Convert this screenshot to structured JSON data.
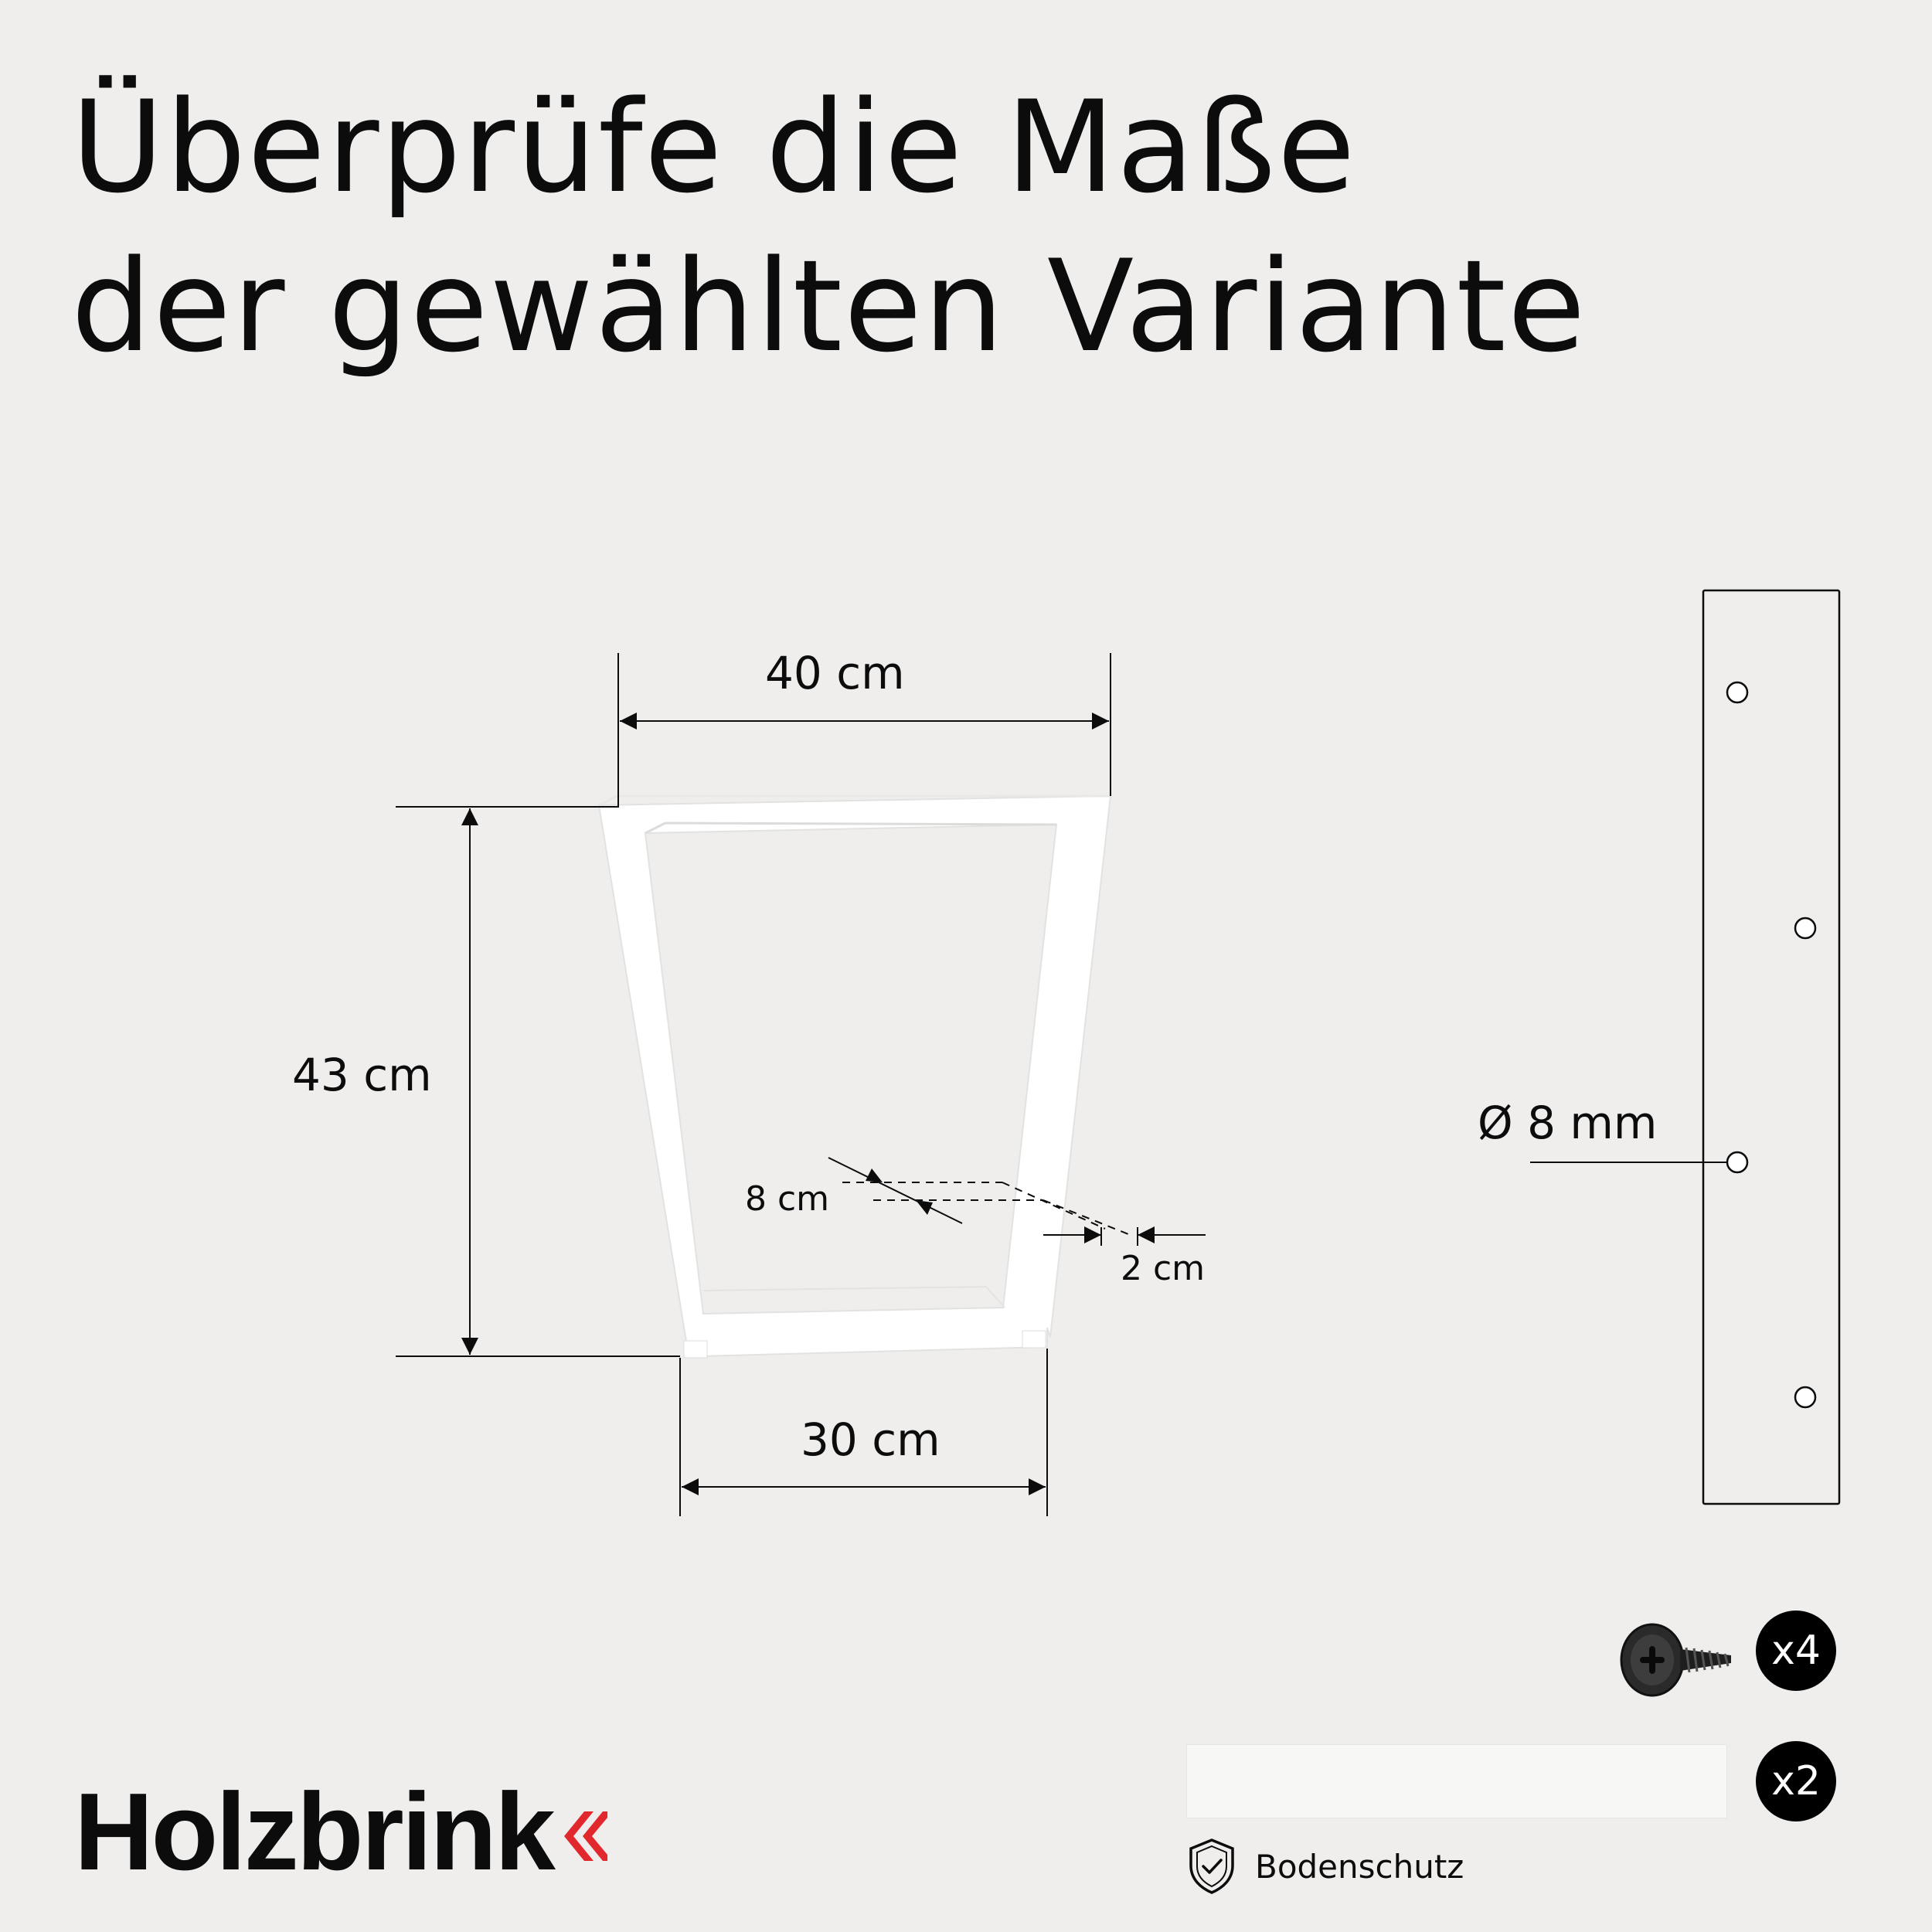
{
  "title": {
    "line1": "Überprüfe die Maße",
    "line2": "der gewählten Variante"
  },
  "dimensions": {
    "top_width": "40 cm",
    "height": "43 cm",
    "bottom_width": "30 cm",
    "profile_depth": "8 cm",
    "profile_thickness": "2 cm",
    "hole_diameter": "Ø 8 mm"
  },
  "accessories": {
    "screws_count": "x4",
    "pads_count": "x2",
    "pads_label": "Bodenschutz",
    "screw_icon": "screw-icon",
    "shield_icon": "shield-check-icon"
  },
  "brand": {
    "name": "Holzbrink",
    "accent_color": "#e0282d"
  },
  "colors": {
    "background": "#efeeed",
    "leg": "#ffffff",
    "line": "#0c0c0c"
  }
}
